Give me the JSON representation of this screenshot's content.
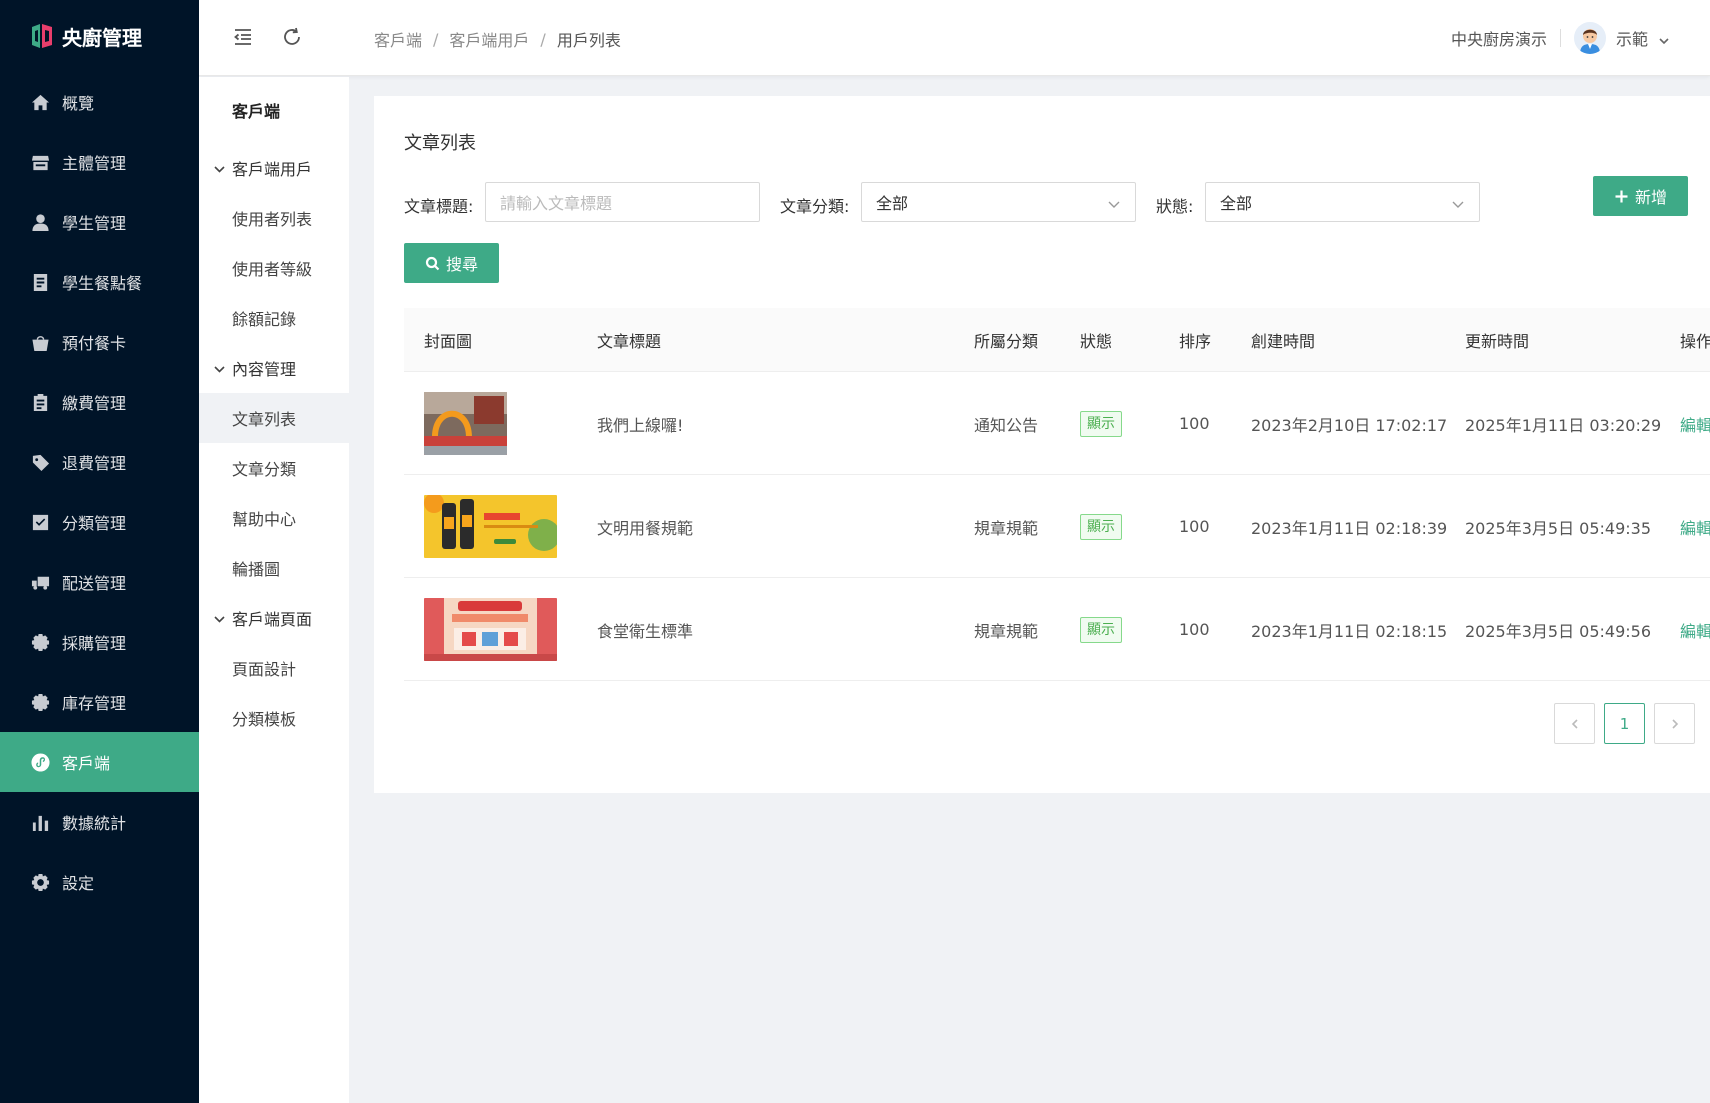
{
  "app": {
    "title": "央廚管理"
  },
  "sidebar": {
    "items": [
      {
        "label": "概覽",
        "icon": "home-icon"
      },
      {
        "label": "主體管理",
        "icon": "store-icon"
      },
      {
        "label": "學生管理",
        "icon": "user-icon"
      },
      {
        "label": "學生餐點餐",
        "icon": "document-icon"
      },
      {
        "label": "預付餐卡",
        "icon": "bag-icon"
      },
      {
        "label": "繳費管理",
        "icon": "clipboard-icon"
      },
      {
        "label": "退費管理",
        "icon": "tag-icon"
      },
      {
        "label": "分類管理",
        "icon": "check-box-icon"
      },
      {
        "label": "配送管理",
        "icon": "truck-icon"
      },
      {
        "label": "採購管理",
        "icon": "gear-box-icon"
      },
      {
        "label": "庫存管理",
        "icon": "gear-box-icon"
      },
      {
        "label": "客戶端",
        "icon": "miniprogram-icon",
        "active": true
      },
      {
        "label": "數據統計",
        "icon": "bar-chart-icon"
      },
      {
        "label": "設定",
        "icon": "settings-icon"
      }
    ]
  },
  "header": {
    "breadcrumb": [
      "客戶端",
      "客戶端用戶",
      "用戶列表"
    ],
    "org_name": "中央廚房演示",
    "user_name": "示範"
  },
  "submenu": {
    "title": "客戶端",
    "groups": [
      {
        "label": "客戶端用戶",
        "items": [
          "使用者列表",
          "使用者等級",
          "餘額記錄"
        ]
      },
      {
        "label": "內容管理",
        "items": [
          "文章列表",
          "文章分類",
          "幫助中心",
          "輪播圖"
        ]
      },
      {
        "label": "客戶端頁面",
        "items": [
          "頁面設計",
          "分類模板"
        ]
      }
    ],
    "active_item": "文章列表"
  },
  "page": {
    "title": "文章列表",
    "filters": {
      "title_label": "文章標題:",
      "title_placeholder": "請輸入文章標題",
      "category_label": "文章分類:",
      "category_value": "全部",
      "status_label": "狀態:",
      "status_value": "全部"
    },
    "add_button": "新增",
    "search_button": "搜尋"
  },
  "table": {
    "columns": [
      "封面圖",
      "文章標題",
      "所屬分類",
      "狀態",
      "排序",
      "創建時間",
      "更新時間",
      "操作"
    ],
    "rows": [
      {
        "title": "我們上線囉!",
        "category": "通知公告",
        "status": "顯示",
        "sort": "100",
        "created": "2023年2月10日 17:02:17",
        "updated": "2025年1月11日 03:20:29",
        "action": "編輯"
      },
      {
        "title": "文明用餐規範",
        "category": "規章規範",
        "status": "顯示",
        "sort": "100",
        "created": "2023年1月11日 02:18:39",
        "updated": "2025年3月5日 05:49:35",
        "action": "編輯"
      },
      {
        "title": "食堂衛生標準",
        "category": "規章規範",
        "status": "顯示",
        "sort": "100",
        "created": "2023年1月11日 02:18:15",
        "updated": "2025年3月5日 05:49:56",
        "action": "編輯"
      }
    ]
  },
  "pagination": {
    "current": "1"
  },
  "colors": {
    "sidebar_bg": "#001428",
    "accent": "#3eaa87",
    "tag_green": "#4caf50"
  }
}
